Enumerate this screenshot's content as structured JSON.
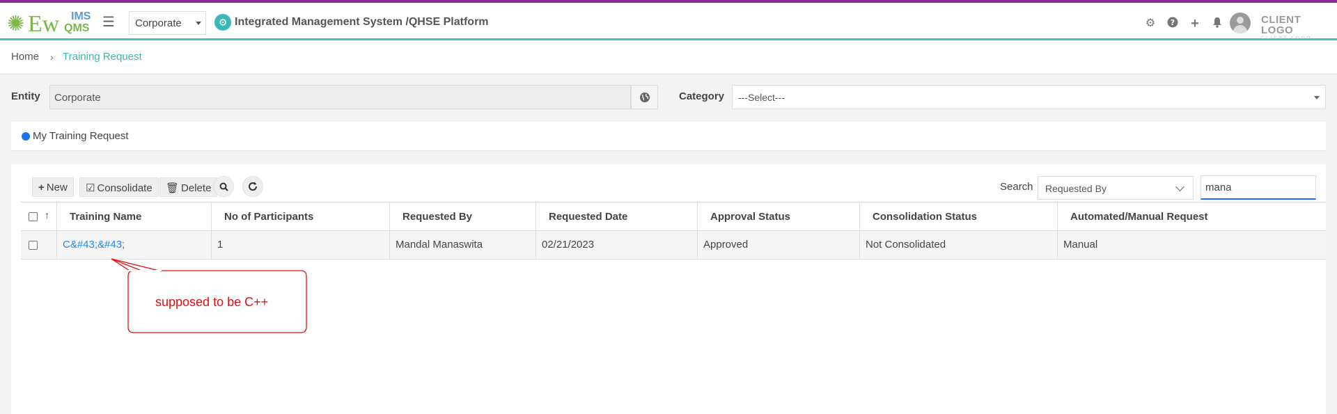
{
  "header": {
    "logo": {
      "ew": "Ew",
      "ims": "IMS",
      "qms": "QMS"
    },
    "entity_select": "Corporate",
    "app_title": "Integrated Management System /QHSE Platform",
    "icons": [
      "gear-icon",
      "help-icon",
      "plus-icon",
      "bell-icon",
      "avatar"
    ],
    "client_logo": {
      "line1": "CLIENT LOGO",
      "line2": "CLIENT LOGO"
    }
  },
  "breadcrumb": {
    "home": "Home",
    "separator": "›",
    "current": "Training Request"
  },
  "filters": {
    "entity_label": "Entity",
    "entity_value": "Corporate",
    "category_label": "Category",
    "category_value": "---Select---"
  },
  "panel": {
    "title": "My Training Request"
  },
  "toolbar": {
    "new_label": "New",
    "consolidate_label": "Consolidate",
    "delete_label": "Delete",
    "search_label": "Search",
    "search_by": "Requested By",
    "search_value": "mana"
  },
  "table": {
    "columns": [
      "Training Name",
      "No of Participants",
      "Requested By",
      "Requested Date",
      "Approval Status",
      "Consolidation Status",
      "Automated/Manual Request"
    ],
    "rows": [
      {
        "training_name": "C&#43;&#43;",
        "participants": "1",
        "requested_by": "Mandal Manaswita",
        "requested_date": "02/21/2023",
        "approval_status": "Approved",
        "consolidation_status": "Not Consolidated",
        "request_type": "Manual"
      }
    ]
  },
  "annotation": {
    "text": "supposed to be C++",
    "color": "#e01010"
  },
  "colors": {
    "accent_teal": "#3bb7b7",
    "top_bar_purple": "#8e2c8e",
    "link_blue": "#1e88e5",
    "primary_blue": "#1a73e8"
  }
}
